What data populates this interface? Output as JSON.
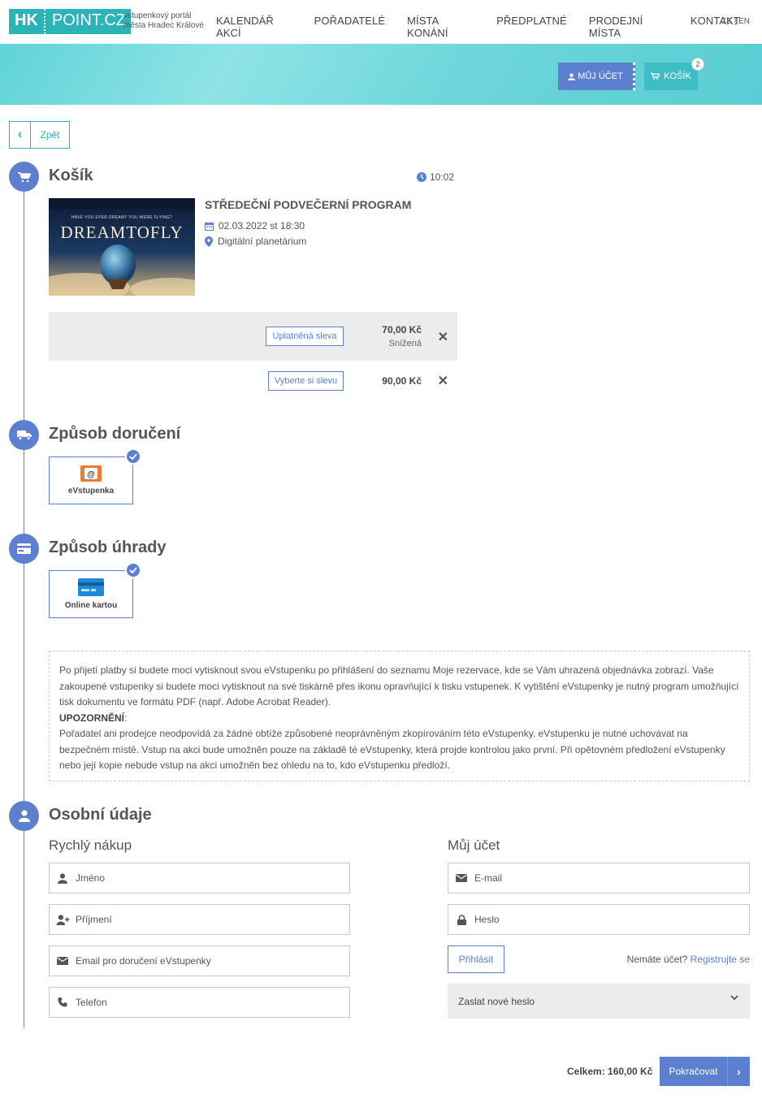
{
  "header": {
    "logo_hk": "HK",
    "logo_point": "POINT.CZ",
    "tagline_1": "vstupenkový portál",
    "tagline_2": "města Hradec Králové",
    "nav": [
      "KALENDÁŘ AKCÍ",
      "POŘADATELÉ",
      "MÍSTA KONÁNÍ",
      "PŘEDPLATNÉ",
      "PRODEJNÍ MÍSTA",
      "KONTAKT"
    ],
    "lang_cs": "CS",
    "lang_sep": "|",
    "lang_en": "EN",
    "account_label": "MŮJ ÚČET",
    "cart_label": "KOŠÍK",
    "cart_count": "2"
  },
  "back_label": "Zpět",
  "cart": {
    "heading": "Košík",
    "timer": "10:02",
    "event": {
      "image_text": "DREAMTOFLY",
      "image_tagline": "HAVE YOU EVER DREAMT YOU WERE FLYING?",
      "title": "STŘEDEČNÍ PODVEČERNÍ PROGRAM",
      "date": "02.03.2022 st 18:30",
      "place": "Digitální planetárium"
    },
    "tickets": [
      {
        "discount_label": "Uplatněná sleva",
        "price": "70,00 Kč",
        "type": "Snížená"
      },
      {
        "discount_label": "Vyberte si slevu",
        "price": "90,00 Kč",
        "type": ""
      }
    ],
    "remove_glyph": "✕"
  },
  "delivery": {
    "heading": "Způsob doručení",
    "option": "eVstupenka"
  },
  "payment": {
    "heading": "Způsob úhrady",
    "option": "Online kartou"
  },
  "info": {
    "p1": "Po přijetí platby si budete moci vytisknout svou eVstupenku po přihlášení do seznamu Moje rezervace, kde se Vám uhrazená objednávka zobrazí. Vaše zakoupené vstupenky si budete moci vytisknout na své tiskárně přes ikonu opravňující k tisku vstupenek. K vytištění eVstupenky je nutný program umožňující tisk dokumentu ve formátu PDF (např. Adobe Acrobat Reader).",
    "warning_label": "UPOZORNĚNÍ",
    "warning_colon": ":",
    "p2": "Pořadatel ani prodejce neodpovídá za žádné obtíže způsobené neoprávněným zkopírováním této eVstupenky. eVstupenku je nutné uchovávat na bezpečném místě. Vstup na akci bude umožněn pouze na základě té eVstupenky, která projde kontrolou jako první. Při opětovném předložení eVstupenky nebo její kopie nebude vstup na akci umožněn bez ohledu na to, kdo eVstupenku předloží."
  },
  "personal": {
    "heading": "Osobní údaje",
    "quick_heading": "Rychlý nákup",
    "quick_fields": [
      "Jméno",
      "Příjmení",
      "Email pro doručení eVstupenky",
      "Telefon"
    ],
    "account_heading": "Můj účet",
    "email_placeholder": "E-mail",
    "password_placeholder": "Heslo",
    "login_label": "Přihlásit",
    "no_account": "Nemáte účet?",
    "register_label": "Registrujte se",
    "new_password_label": "Zaslat nové heslo"
  },
  "footer": {
    "total": "Celkem: 160,00 Kč",
    "continue_label": "Pokračovat"
  },
  "colors": {
    "accent": "#5c7fcf",
    "teal": "#2bb3b8",
    "banner": "#6dd6db"
  }
}
